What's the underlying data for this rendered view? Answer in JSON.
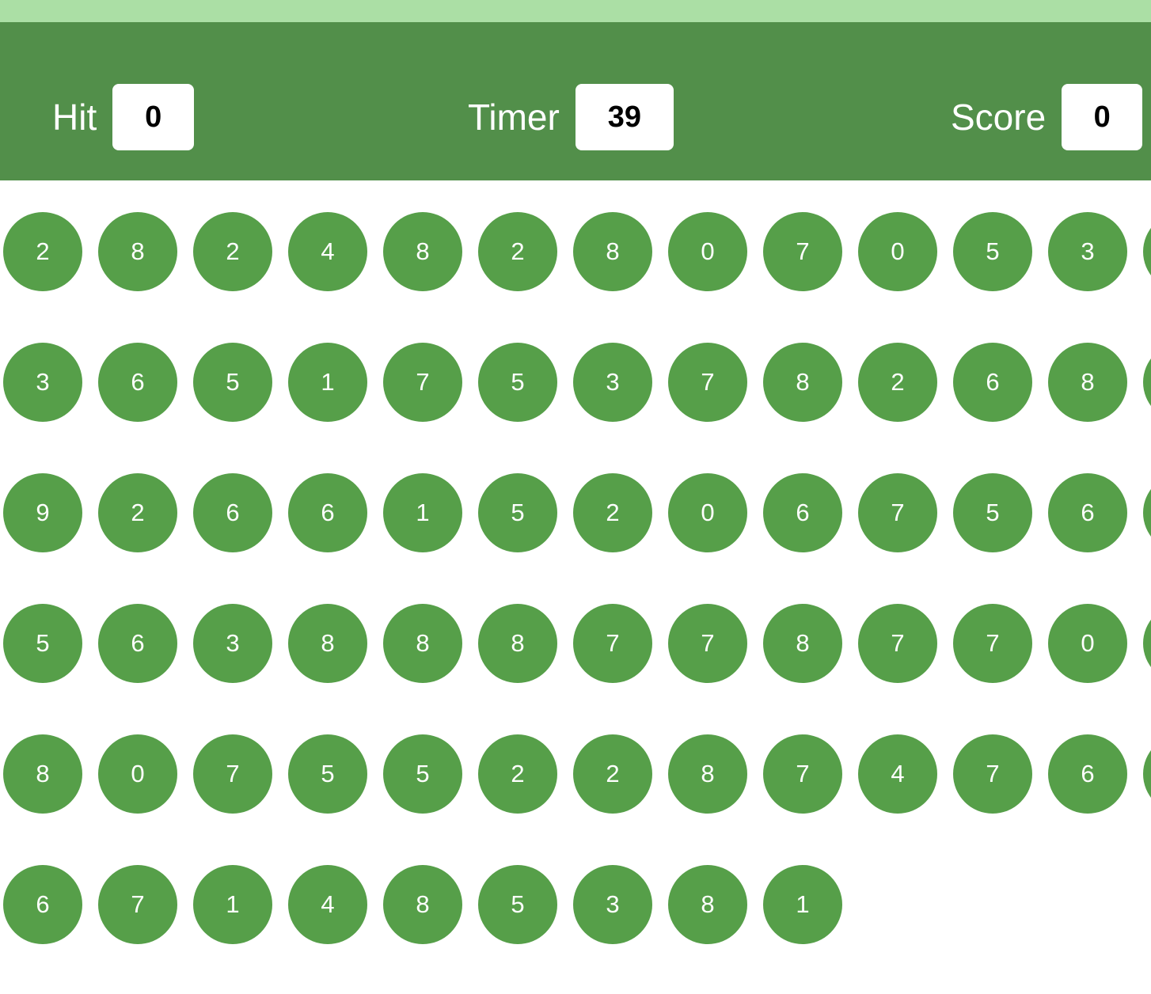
{
  "stats": {
    "hit_label": "Hit",
    "hit_value": "0",
    "timer_label": "Timer",
    "timer_value": "39",
    "score_label": "Score",
    "score_value": "0"
  },
  "colors": {
    "top_strip": "#abdfa5",
    "header": "#528f4a",
    "bubble": "#569f49",
    "bubble_text": "#ffffff"
  },
  "bubbles": [
    [
      "2",
      "8",
      "2",
      "4",
      "8",
      "2",
      "8",
      "0",
      "7",
      "0",
      "5",
      "3",
      ""
    ],
    [
      "3",
      "6",
      "5",
      "1",
      "7",
      "5",
      "3",
      "7",
      "8",
      "2",
      "6",
      "8",
      ""
    ],
    [
      "9",
      "2",
      "6",
      "6",
      "1",
      "5",
      "2",
      "0",
      "6",
      "7",
      "5",
      "6",
      ""
    ],
    [
      "5",
      "6",
      "3",
      "8",
      "8",
      "8",
      "7",
      "7",
      "8",
      "7",
      "7",
      "0",
      ""
    ],
    [
      "8",
      "0",
      "7",
      "5",
      "5",
      "2",
      "2",
      "8",
      "7",
      "4",
      "7",
      "6",
      ""
    ],
    [
      "6",
      "7",
      "1",
      "4",
      "8",
      "5",
      "3",
      "8",
      "1"
    ]
  ]
}
